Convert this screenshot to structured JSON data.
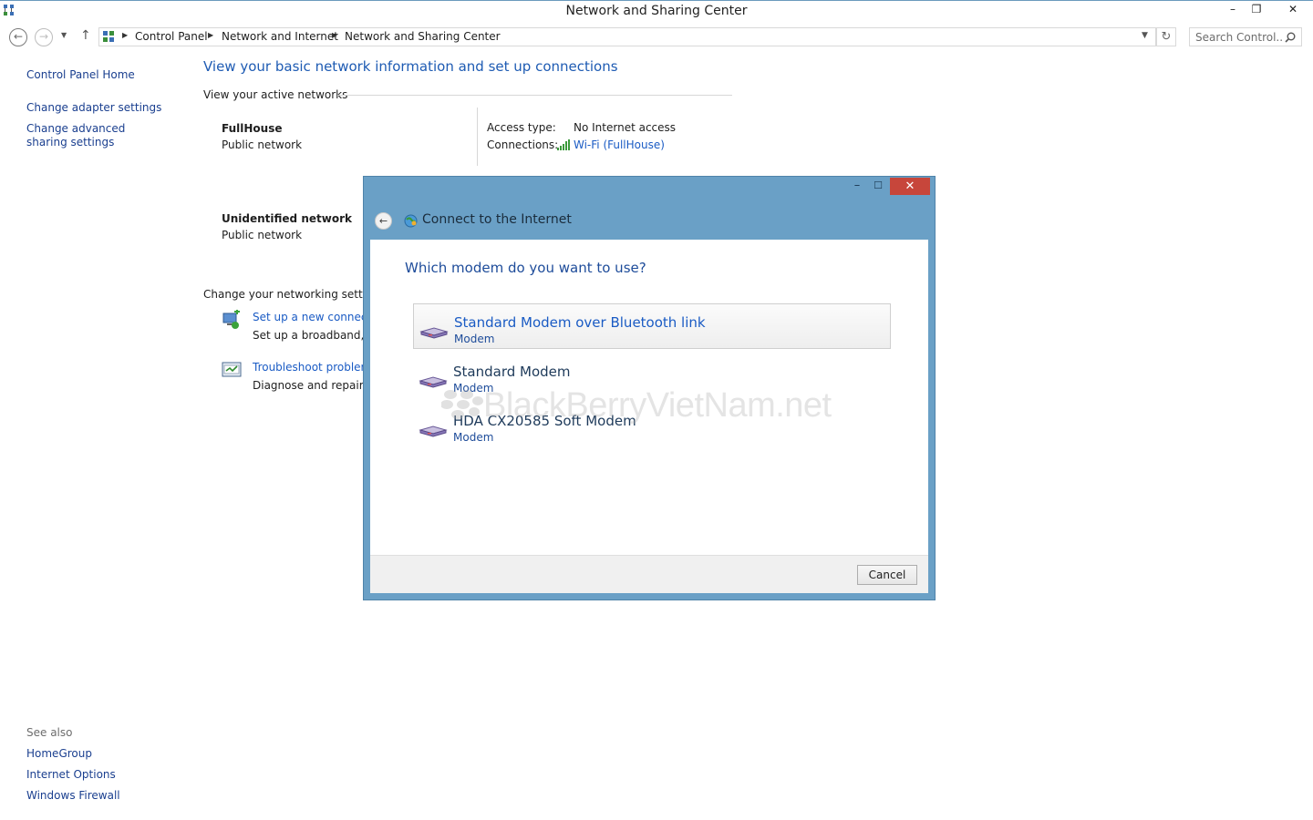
{
  "window": {
    "title": "Network and Sharing Center",
    "minimize": "–",
    "restore": "❐",
    "close": "✕"
  },
  "addressbar": {
    "crumbs": [
      "Control Panel",
      "Network and Internet",
      "Network and Sharing Center"
    ],
    "search_placeholder": "Search Control..."
  },
  "sidebar": {
    "home": "Control Panel Home",
    "items": [
      "Change adapter settings",
      "Change advanced sharing settings"
    ],
    "see_also_label": "See also",
    "see_also": [
      "HomeGroup",
      "Internet Options",
      "Windows Firewall"
    ]
  },
  "main": {
    "heading": "View your basic network information and set up connections",
    "active_label": "View your active networks",
    "networks": [
      {
        "name": "FullHouse",
        "type": "Public network"
      },
      {
        "name": "Unidentified network",
        "type": "Public network"
      }
    ],
    "access_type_label": "Access type:",
    "access_type_value": "No Internet access",
    "connections_label": "Connections:",
    "connections_value": "Wi-Fi (FullHouse)",
    "change_label": "Change your networking settings",
    "tasks": [
      {
        "title": "Set up a new connectio",
        "desc": "Set up a broadband, dia"
      },
      {
        "title": "Troubleshoot problems",
        "desc": "Diagnose and repair ne"
      }
    ]
  },
  "dialog": {
    "title": "Connect to the Internet",
    "question": "Which modem do you want to use?",
    "modems": [
      {
        "name": "Standard Modem over Bluetooth link",
        "type": "Modem"
      },
      {
        "name": "Standard Modem",
        "type": "Modem"
      },
      {
        "name": "HDA CX20585 Soft Modem",
        "type": "Modem"
      }
    ],
    "cancel": "Cancel",
    "minimize": "–",
    "maximize": "☐",
    "close": "✕"
  },
  "watermark": "BlackBerryVietNam.net",
  "colors": {
    "link": "#1a5bc4",
    "heading": "#1e5bb3",
    "dialog_frame": "#6aa0c6",
    "dialog_close": "#c7463b"
  }
}
